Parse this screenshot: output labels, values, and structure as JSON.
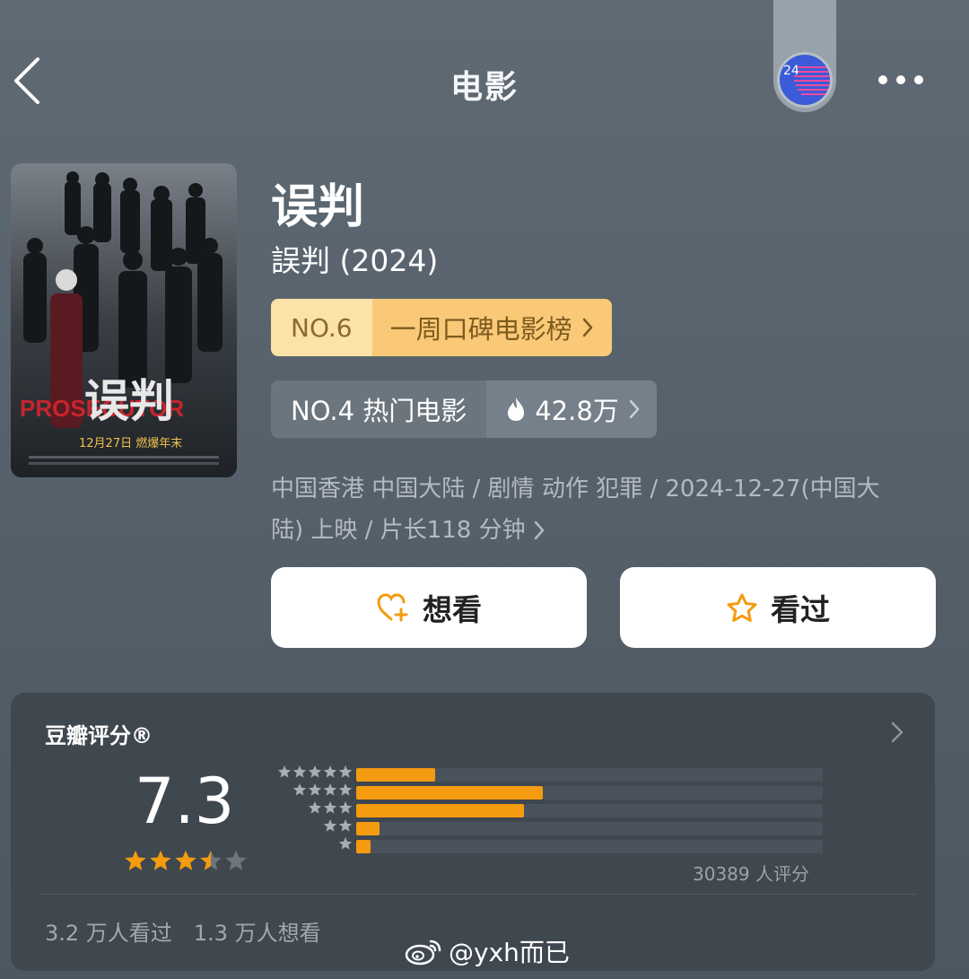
{
  "header": {
    "title": "电影",
    "badge_text": "24"
  },
  "movie": {
    "title_cn": "误判",
    "title_orig": "誤判 (2024)",
    "poster": {
      "title_text": "误判",
      "title_en": "PROSECUTOR",
      "date_text": "12月27日 燃爆年末"
    },
    "rank_week": {
      "no": "NO.6",
      "name": "一周口碑电影榜"
    },
    "rank_hot": {
      "label": "NO.4 热门电影",
      "heat": "42.8万"
    },
    "meta_line1": "中国香港 中国大陆 / 剧情 动作 犯罪 / 2024-12-27(中国大",
    "meta_line2": "陆) 上映 / 片长118 分钟"
  },
  "actions": {
    "want_label": "想看",
    "seen_label": "看过"
  },
  "rating": {
    "title": "豆瓣评分®",
    "score": "7.3",
    "stars": 3.5,
    "distribution": [
      {
        "stars": 5,
        "fraction": 0.17
      },
      {
        "stars": 4,
        "fraction": 0.4
      },
      {
        "stars": 3,
        "fraction": 0.36
      },
      {
        "stars": 2,
        "fraction": 0.05
      },
      {
        "stars": 1,
        "fraction": 0.03
      }
    ],
    "count_text": "30389 人评分",
    "seen_text": "3.2 万人看过",
    "want_text": "1.3 万人想看"
  },
  "watermark": {
    "text": "@yxh而已"
  },
  "colors": {
    "accent": "#f49b10",
    "gold_light": "#fbe2a8",
    "gold": "#f9c978",
    "card": "#3f474f"
  }
}
